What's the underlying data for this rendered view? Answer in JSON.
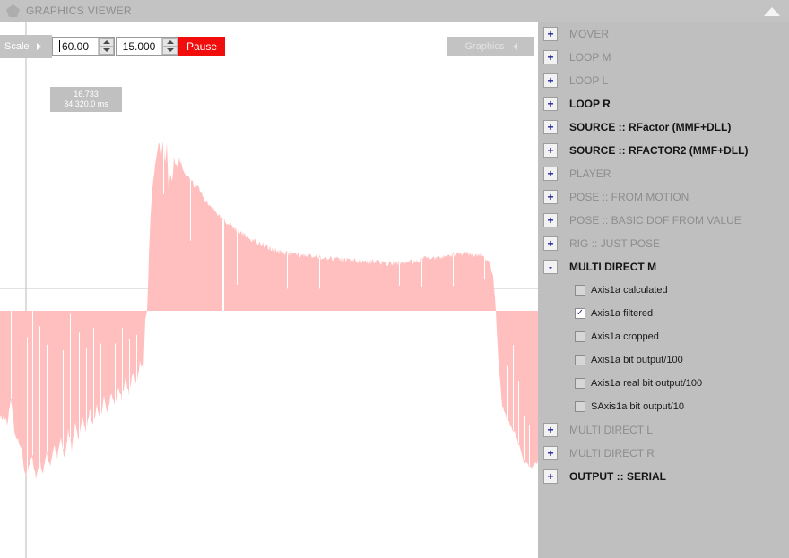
{
  "window": {
    "title": "GRAPHICS VIEWER",
    "icon": "pentagon-icon",
    "collapse_icon": "triangle-up-icon"
  },
  "colors": {
    "panel_bg": "#bfbfbf",
    "titlebar_bg": "#c3c3c3",
    "graph_bg": "#ffffff",
    "waveform_fill": "#ffbfbf",
    "pause_bg": "#f20d0d",
    "gridline": "#b9b9b9",
    "tree_strong_text": "#141414",
    "tree_dim_text": "#8d8d8d",
    "expander_glyph": "#23239c"
  },
  "toolbar": {
    "scale_label": "Scale",
    "scale_arrow_icon": "triangle-right-icon",
    "scale_value": "60.00",
    "scale_placeholder": "60.00",
    "time_value": "15.000",
    "time_placeholder": "15.000",
    "pause_label": "Pause",
    "graphics_label": "Graphics",
    "graphics_arrow_icon": "triangle-left-icon",
    "spin_up_icon": "spin-up-icon",
    "spin_down_icon": "spin-down-icon"
  },
  "graph": {
    "readout_value": "16.733",
    "readout_time": "34,320.0 ms"
  },
  "chart_data": {
    "type": "area",
    "title": "",
    "xlabel": "",
    "ylabel": "",
    "series_name": "Axis1a filtered",
    "fill_color": "#ffbfbf",
    "zero_line_y": 322,
    "grid": true,
    "gridlines_x": [
      29
    ],
    "xlim": [
      0,
      600
    ],
    "ylim": [
      -1,
      1
    ],
    "cursor_value": 16.733,
    "cursor_time_ms": 34320.0,
    "points": [
      [
        0,
        -0.62
      ],
      [
        4,
        -0.63
      ],
      [
        8,
        -0.66
      ],
      [
        12,
        -0.52
      ],
      [
        16,
        -0.7
      ],
      [
        20,
        -0.76
      ],
      [
        24,
        -0.8
      ],
      [
        28,
        -0.97
      ],
      [
        32,
        -0.92
      ],
      [
        36,
        -0.85
      ],
      [
        40,
        -0.99
      ],
      [
        44,
        -0.88
      ],
      [
        48,
        -0.96
      ],
      [
        52,
        -0.83
      ],
      [
        56,
        -0.93
      ],
      [
        60,
        -0.79
      ],
      [
        64,
        -0.86
      ],
      [
        68,
        -0.74
      ],
      [
        72,
        -0.88
      ],
      [
        76,
        -0.7
      ],
      [
        80,
        -0.81
      ],
      [
        84,
        -0.66
      ],
      [
        88,
        -0.76
      ],
      [
        92,
        -0.62
      ],
      [
        96,
        -0.72
      ],
      [
        100,
        -0.58
      ],
      [
        104,
        -0.68
      ],
      [
        108,
        -0.55
      ],
      [
        112,
        -0.64
      ],
      [
        116,
        -0.5
      ],
      [
        120,
        -0.6
      ],
      [
        124,
        -0.47
      ],
      [
        128,
        -0.56
      ],
      [
        132,
        -0.44
      ],
      [
        136,
        -0.52
      ],
      [
        140,
        -0.4
      ],
      [
        144,
        -0.48
      ],
      [
        148,
        -0.36
      ],
      [
        152,
        -0.43
      ],
      [
        156,
        -0.3
      ],
      [
        160,
        -0.34
      ],
      [
        162,
        -0.05
      ],
      [
        164,
        0.0
      ],
      [
        166,
        0.3
      ],
      [
        168,
        0.58
      ],
      [
        170,
        0.72
      ],
      [
        172,
        0.81
      ],
      [
        174,
        0.9
      ],
      [
        176,
        0.95
      ],
      [
        178,
        0.99
      ],
      [
        180,
        0.93
      ],
      [
        182,
        1.0
      ],
      [
        184,
        0.88
      ],
      [
        186,
        0.97
      ],
      [
        188,
        0.72
      ],
      [
        190,
        0.8
      ],
      [
        192,
        0.76
      ],
      [
        194,
        0.9
      ],
      [
        196,
        0.86
      ],
      [
        198,
        0.83
      ],
      [
        200,
        0.89
      ],
      [
        204,
        0.84
      ],
      [
        208,
        0.8
      ],
      [
        212,
        0.78
      ],
      [
        216,
        0.74
      ],
      [
        220,
        0.73
      ],
      [
        224,
        0.69
      ],
      [
        228,
        0.66
      ],
      [
        232,
        0.63
      ],
      [
        236,
        0.61
      ],
      [
        240,
        0.58
      ],
      [
        244,
        0.56
      ],
      [
        248,
        0.54
      ],
      [
        252,
        0.52
      ],
      [
        256,
        0.51
      ],
      [
        260,
        0.49
      ],
      [
        264,
        0.47
      ],
      [
        268,
        0.46
      ],
      [
        272,
        0.45
      ],
      [
        276,
        0.43
      ],
      [
        280,
        0.42
      ],
      [
        284,
        0.41
      ],
      [
        288,
        0.4
      ],
      [
        292,
        0.39
      ],
      [
        296,
        0.38
      ],
      [
        300,
        0.37
      ],
      [
        310,
        0.35
      ],
      [
        320,
        0.34
      ],
      [
        330,
        0.33
      ],
      [
        340,
        0.32
      ],
      [
        350,
        0.32
      ],
      [
        360,
        0.31
      ],
      [
        370,
        0.31
      ],
      [
        380,
        0.3
      ],
      [
        390,
        0.3
      ],
      [
        400,
        0.29
      ],
      [
        410,
        0.29
      ],
      [
        420,
        0.29
      ],
      [
        430,
        0.28
      ],
      [
        440,
        0.28
      ],
      [
        450,
        0.28
      ],
      [
        460,
        0.29
      ],
      [
        470,
        0.3
      ],
      [
        480,
        0.31
      ],
      [
        490,
        0.32
      ],
      [
        500,
        0.33
      ],
      [
        510,
        0.33
      ],
      [
        520,
        0.34
      ],
      [
        530,
        0.33
      ],
      [
        540,
        0.32
      ],
      [
        545,
        0.3
      ],
      [
        550,
        0.2
      ],
      [
        553,
        0.0
      ],
      [
        556,
        -0.3
      ],
      [
        560,
        -0.55
      ],
      [
        564,
        -0.62
      ],
      [
        568,
        -0.66
      ],
      [
        572,
        -0.7
      ],
      [
        576,
        -0.74
      ],
      [
        580,
        -0.82
      ],
      [
        584,
        -0.88
      ],
      [
        588,
        -0.9
      ],
      [
        592,
        -0.92
      ],
      [
        596,
        -0.91
      ],
      [
        600,
        -0.9
      ]
    ]
  },
  "tree": {
    "items": [
      {
        "label": "MOVER",
        "expander": "+",
        "style": "dim",
        "type": "node"
      },
      {
        "label": "LOOP M",
        "expander": "+",
        "style": "dim",
        "type": "node"
      },
      {
        "label": "LOOP L",
        "expander": "+",
        "style": "dim",
        "type": "node"
      },
      {
        "label": "LOOP R",
        "expander": "+",
        "style": "strong",
        "type": "node"
      },
      {
        "label": "SOURCE :: RFactor (MMF+DLL)",
        "expander": "+",
        "style": "strong",
        "type": "node"
      },
      {
        "label": "SOURCE :: RFACTOR2 (MMF+DLL)",
        "expander": "+",
        "style": "strong",
        "type": "node"
      },
      {
        "label": "PLAYER",
        "expander": "+",
        "style": "dim",
        "type": "node"
      },
      {
        "label": "POSE :: FROM MOTION",
        "expander": "+",
        "style": "dim",
        "type": "node"
      },
      {
        "label": "POSE :: BASIC DOF FROM VALUE",
        "expander": "+",
        "style": "dim",
        "type": "node"
      },
      {
        "label": "RIG :: JUST POSE",
        "expander": "+",
        "style": "dim",
        "type": "node"
      },
      {
        "label": "MULTI DIRECT M",
        "expander": "-",
        "style": "strong",
        "type": "node"
      },
      {
        "label": "Axis1a calculated",
        "checked": false,
        "type": "check"
      },
      {
        "label": "Axis1a filtered",
        "checked": true,
        "type": "check"
      },
      {
        "label": "Axis1a cropped",
        "checked": false,
        "type": "check"
      },
      {
        "label": "Axis1a bit output/100",
        "checked": false,
        "type": "check"
      },
      {
        "label": "Axis1a real bit output/100",
        "checked": false,
        "type": "check"
      },
      {
        "label": "SAxis1a bit output/10",
        "checked": false,
        "type": "check"
      },
      {
        "label": "MULTI DIRECT L",
        "expander": "+",
        "style": "dim",
        "type": "node"
      },
      {
        "label": "MULTI DIRECT R",
        "expander": "+",
        "style": "dim",
        "type": "node"
      },
      {
        "label": "OUTPUT :: SERIAL",
        "expander": "+",
        "style": "strong",
        "type": "node"
      }
    ],
    "check_glyph": "✓"
  }
}
